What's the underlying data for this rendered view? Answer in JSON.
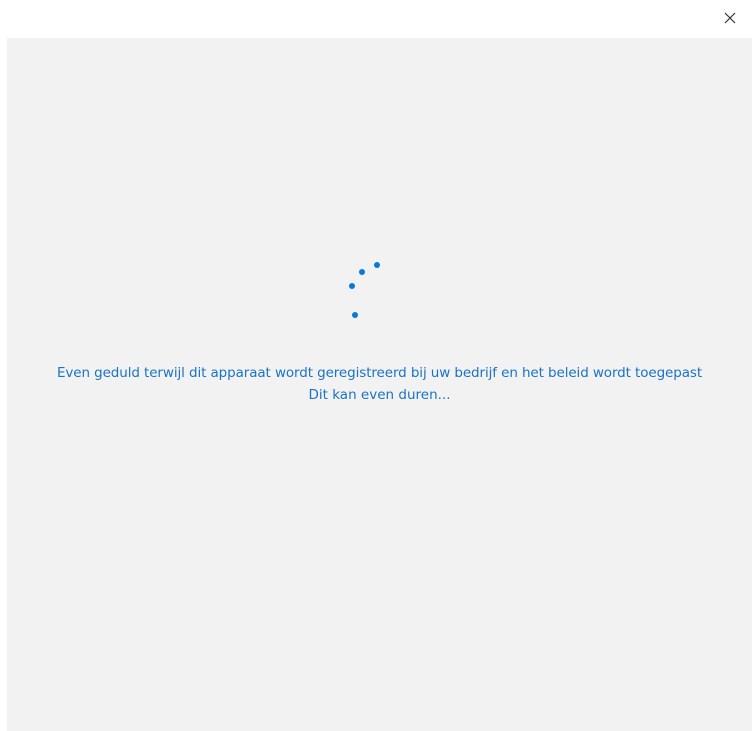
{
  "window": {
    "close_glyph": "×"
  },
  "status": {
    "message": "Even geduld terwijl dit apparaat wordt geregistreerd bij uw bedrijf en het beleid wordt toegepast",
    "submessage": "Dit kan even duren..."
  },
  "colors": {
    "accent": "#0a78d7",
    "text": "#1a73c8",
    "panel": "#f2f2f2"
  },
  "icons": {
    "close": "close-icon",
    "spinner": "loading-spinner-icon"
  }
}
